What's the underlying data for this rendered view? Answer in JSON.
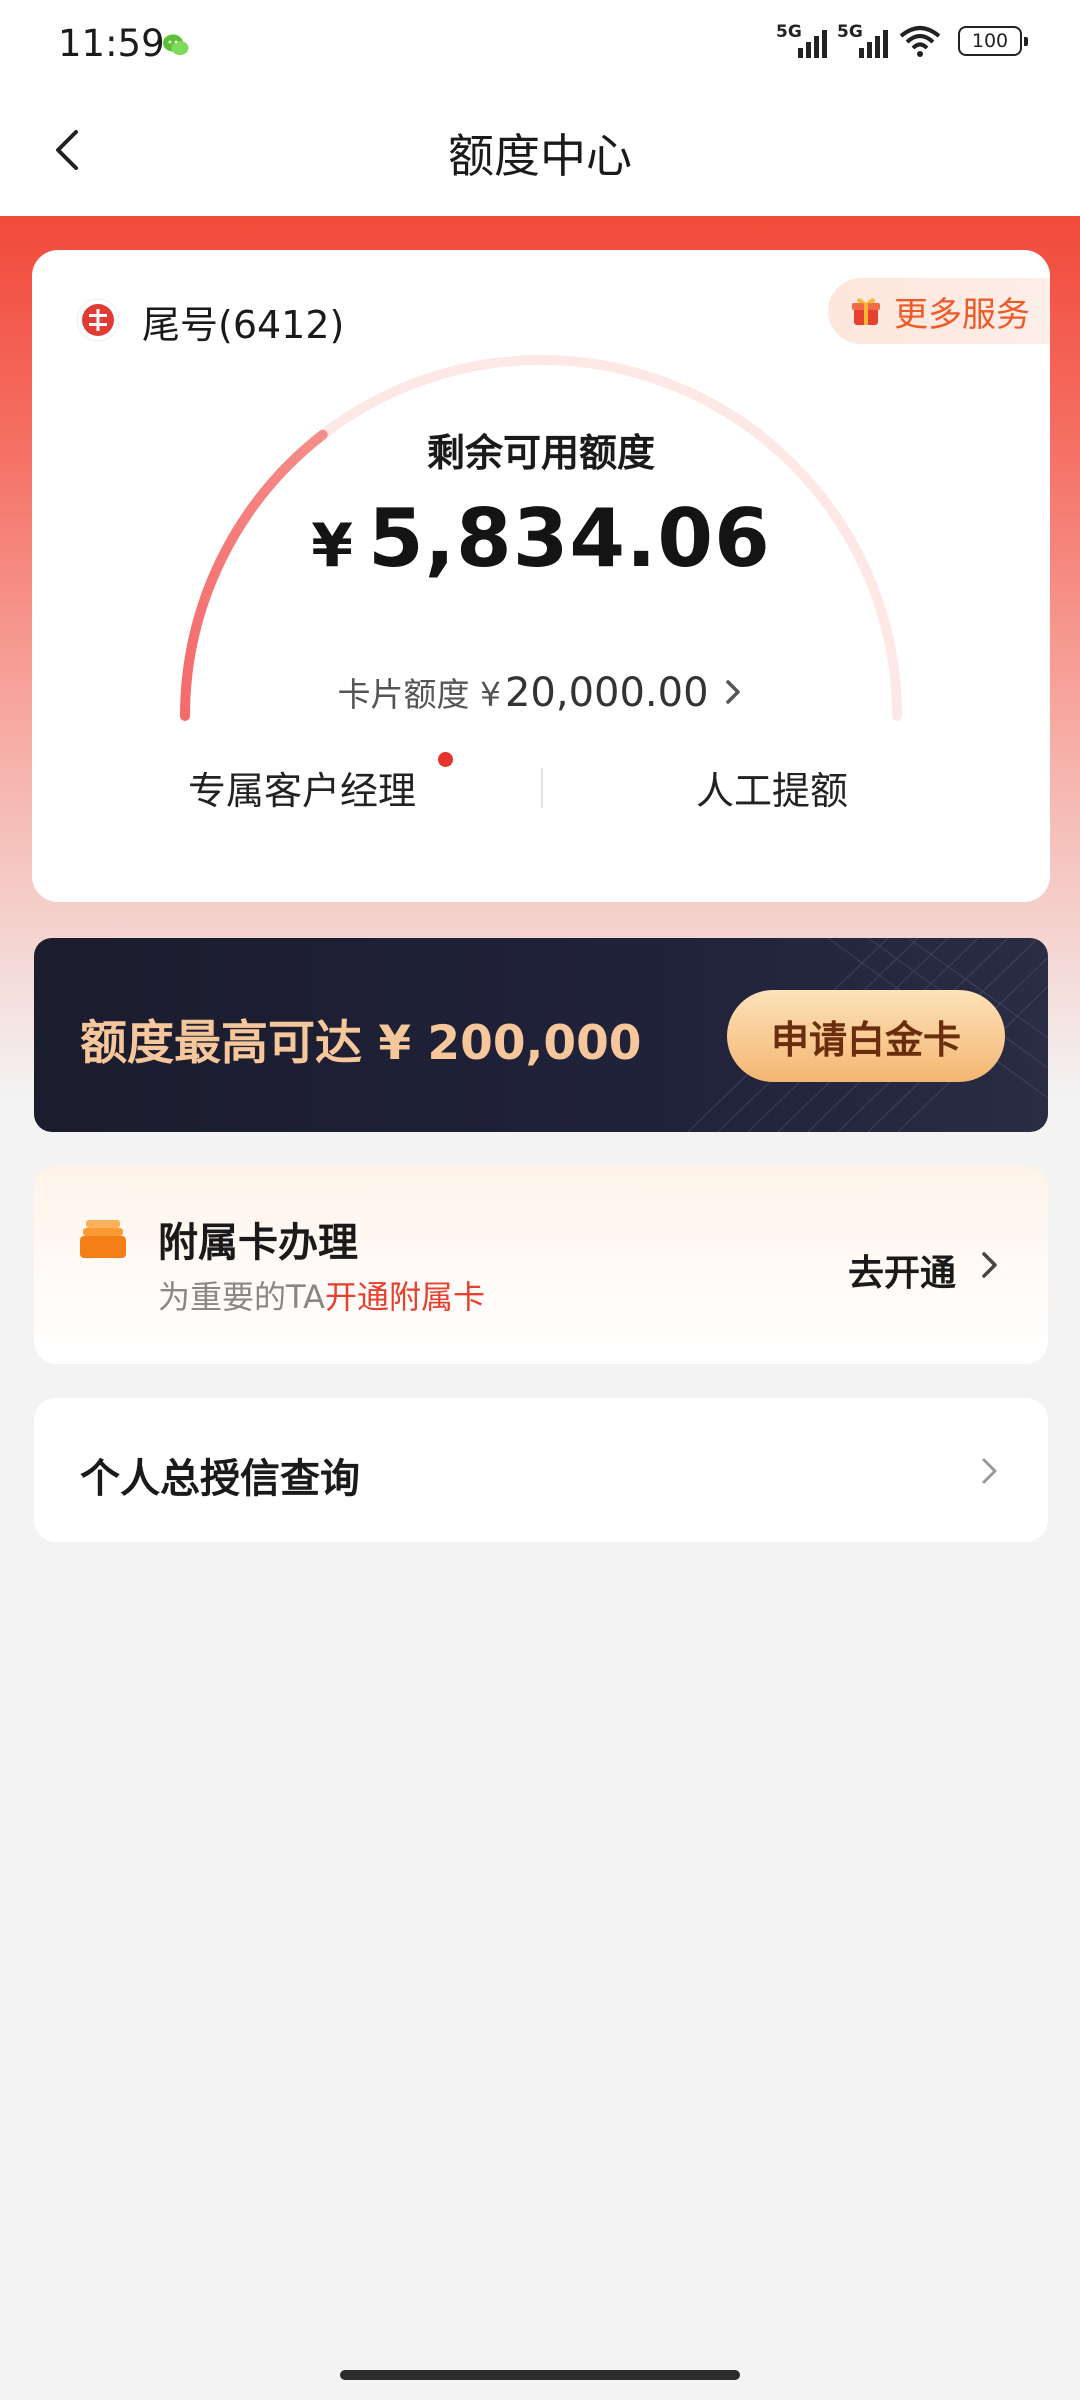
{
  "status_bar": {
    "time": "11:59",
    "sig1": "5G",
    "sig2": "5G",
    "battery": "100"
  },
  "nav": {
    "title": "额度中心"
  },
  "card": {
    "tail_label": "尾号(6412)",
    "more_services": "更多服务",
    "remain_label": "剩余可用额度",
    "currency": "¥",
    "remain_amount": "5,834.06",
    "limit_label": "卡片额度 ¥",
    "limit_amount": "20,000.00",
    "gauge_used_fraction": 0.71,
    "manager_link": "专属客户经理",
    "manual_link": "人工提额"
  },
  "promo": {
    "text": "额度最高可达 ¥ 200,000",
    "button": "申请白金卡"
  },
  "supplementary": {
    "title": "附属卡办理",
    "sub_prefix": "为重要的TA",
    "sub_highlight": "开通附属卡",
    "action": "去开通"
  },
  "credit_query": {
    "title": "个人总授信查询"
  },
  "colors": {
    "brand_red": "#f14a3a",
    "accent_orange": "#ee5a28",
    "promo_gold": "#f7c79c",
    "highlight_red": "#e8402f"
  }
}
